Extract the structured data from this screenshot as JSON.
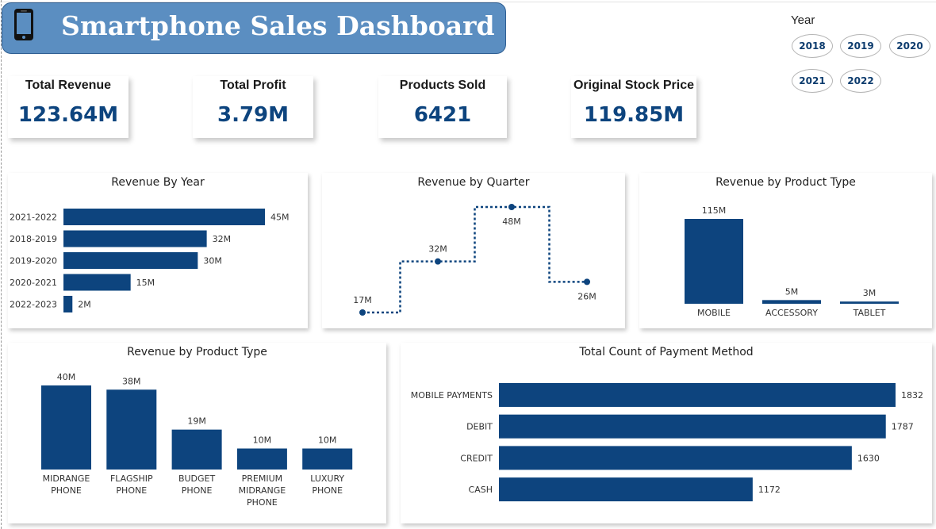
{
  "header": {
    "title": "Smartphone Sales Dashboard",
    "icon": "smartphone-icon"
  },
  "kpis": [
    {
      "label": "Total Revenue",
      "value": "123.64M"
    },
    {
      "label": "Total Profit",
      "value": "3.79M"
    },
    {
      "label": "Products Sold",
      "value": "6421"
    },
    {
      "label": "Original Stock Price",
      "value": "119.85M"
    }
  ],
  "year_slicer": {
    "title": "Year",
    "options": [
      "2018",
      "2019",
      "2020",
      "2021",
      "2022"
    ]
  },
  "colors": {
    "bar": "#0d447e",
    "banner": "#5b8ec1",
    "kpi_value": "#0d447e"
  },
  "chart_data": [
    {
      "id": "revenue-by-year",
      "type": "bar",
      "orientation": "horizontal",
      "title": "Revenue By Year",
      "categories": [
        "2021-2022",
        "2018-2019",
        "2019-2020",
        "2020-2021",
        "2022-2023"
      ],
      "values": [
        45,
        32,
        30,
        15,
        2
      ],
      "value_labels": [
        "45M",
        "32M",
        "30M",
        "15M",
        "2M"
      ],
      "unit": "M"
    },
    {
      "id": "revenue-by-quarter",
      "type": "line",
      "line_style": "dotted-step",
      "title": "Revenue by Quarter",
      "values": [
        17,
        32,
        48,
        26
      ],
      "value_labels": [
        "17M",
        "32M",
        "48M",
        "26M"
      ],
      "unit": "M"
    },
    {
      "id": "revenue-by-product-type-1",
      "type": "bar",
      "orientation": "vertical",
      "title": "Revenue by Product Type",
      "categories": [
        "MOBILE",
        "ACCESSORY",
        "TABLET"
      ],
      "values": [
        115,
        5,
        3
      ],
      "value_labels": [
        "115M",
        "5M",
        "3M"
      ],
      "unit": "M"
    },
    {
      "id": "revenue-by-product-type-2",
      "type": "bar",
      "orientation": "vertical",
      "title": "Revenue by Product Type",
      "categories": [
        "MIDRANGE PHONE",
        "FLAGSHIP PHONE",
        "BUDGET PHONE",
        "PREMIUM MIDRANGE PHONE",
        "LUXURY PHONE"
      ],
      "values": [
        40,
        38,
        19,
        10,
        10
      ],
      "value_labels": [
        "40M",
        "38M",
        "19M",
        "10M",
        "10M"
      ],
      "unit": "M"
    },
    {
      "id": "payment-method-count",
      "type": "bar",
      "orientation": "horizontal",
      "title": "Total Count of Payment Method",
      "categories": [
        "MOBILE PAYMENTS",
        "DEBIT",
        "CREDIT",
        "CASH"
      ],
      "values": [
        1832,
        1787,
        1630,
        1172
      ],
      "value_labels": [
        "1832",
        "1787",
        "1630",
        "1172"
      ]
    }
  ]
}
